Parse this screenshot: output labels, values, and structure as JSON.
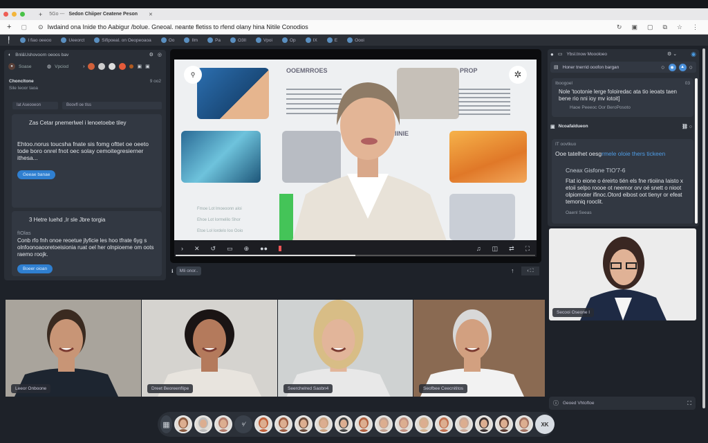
{
  "browser": {
    "tab_title": "Sedon Chiiper Ceatene Peson",
    "tab_prefix": "5Go ---",
    "address": "Iwdaind ona Inide tho Aabigur /bolue. Gneoal. neante fletiss to rfend olany hina Nitile Conodios",
    "bookmarks": [
      "I fiao oeeoo",
      "Ueeorct",
      "Sifipoeal. on Oeopeoaoa",
      "Oo",
      "Ilm",
      "Pa",
      "O3Il",
      "Vpoi",
      "Op",
      "IX",
      "E",
      "Oooi"
    ]
  },
  "left_panel": {
    "header": "Bnl&Ushovoorn oeoos bav",
    "chips": [
      "Soase",
      "Vpciod"
    ],
    "section_title": "Choncltone",
    "section_sub": "Sile Ieoor taoa",
    "section_meta": "9 oo2",
    "filter_left": "Iat Aseooeon",
    "filter_right": "Boovfl oe tIss",
    "card1": {
      "title": "Zas Cetar pnemerlwel i lenoetoebe tiley",
      "body": "Ehtoo.norus toucsha fnate sis fomg ofttet oe oeeto tode boro onrel fnot oec solay cemoitegresierner ithesa...",
      "button": "Geeae banae"
    },
    "card2": {
      "title": "3 Hetre Iuehd ,Ir sle Jbre torgia",
      "sub": "fIOlas",
      "body": "Conb rfo fnh onoe reoetue jlyficie les hoo tfrate 6yg s olnfoonoaooretoeisionia ruat oel her olnpioeme om oots raemo roojk.",
      "button": "Boeer oioan"
    }
  },
  "video": {
    "slide_heads": [
      "OOEMRROES",
      "PROP",
      "IIIINIE"
    ],
    "slide_lines": [
      "Fmoe Lot lmoeoonn aIoi",
      "Ehoe Lot Iormelilo Shor",
      "Etoe Lol Iordelo Ioo Ooio"
    ],
    "caption_label": "MIi onor..",
    "progress": 0.5
  },
  "right_panel": {
    "header": "Ybsl.tnow Moooloeo",
    "search": "Honer tnerrid ooofon bargan",
    "card1": {
      "label": "Iboogoel",
      "meta": "03",
      "body": "Nole 'tootonie lerge foloiredac ata tio ieoats taen bene rio nni ioy mv iotoit]",
      "foot": "Haoe Peeeoc Oor BeroPosoto"
    },
    "section_title": "Ncoafaldueon",
    "card2": {
      "label": "IT oovtkuo",
      "title_a": "Ooe tatelhet oesg",
      "title_b": "rmele oloie thers tickeen",
      "sub": "Cneax Gisfone TIO'7-6",
      "body": "Ftat io eione o éreirto tién els fne rtioiina Iaisto x etoii selpo roooe ot neemor orv oé snett o nioot olpiomoter ifinoc.Otord eibost oot tienyr or efeat temoniq rooclit.",
      "foot": "Oaenl Seeas"
    },
    "video_name": "Secooi Oseone I",
    "bottom_item": "Geoed Vhtoftoe"
  },
  "tiles": [
    {
      "name": "Leeor Onboone",
      "bg": "#a9a49c",
      "skin": "#c89576",
      "hair": "#3a2a20",
      "shirt": "#1d2530"
    },
    {
      "name": "Dreet Beoreenflipe",
      "bg": "#d5d3cf",
      "skin": "#b47a5c",
      "hair": "#1a1414",
      "shirt": "#e8e4de"
    },
    {
      "name": "Seerchelred Saobn4",
      "bg": "#cfd2d2",
      "skin": "#e2b59a",
      "hair": "#d8bd86",
      "shirt": "#e8e8e8"
    },
    {
      "name": "Seofbee Ceecnititos",
      "bg": "#8a6a52",
      "skin": "#d2a080",
      "hair": "#d8d8d8",
      "shirt": "#f2f2f2"
    }
  ],
  "dock": {
    "more_label": "XK",
    "avatar_colors": [
      "#8a5a40",
      "#bbbbbb",
      "#b07a6a",
      "#c0603a",
      "#9a5a40",
      "#6a4a3a",
      "#c8a080",
      "#444444",
      "#b06040",
      "#c0a090",
      "#c09080",
      "#d0b090",
      "#c07050",
      "#c8a898",
      "#3a3030",
      "#5a3a30",
      "#a07060"
    ]
  }
}
